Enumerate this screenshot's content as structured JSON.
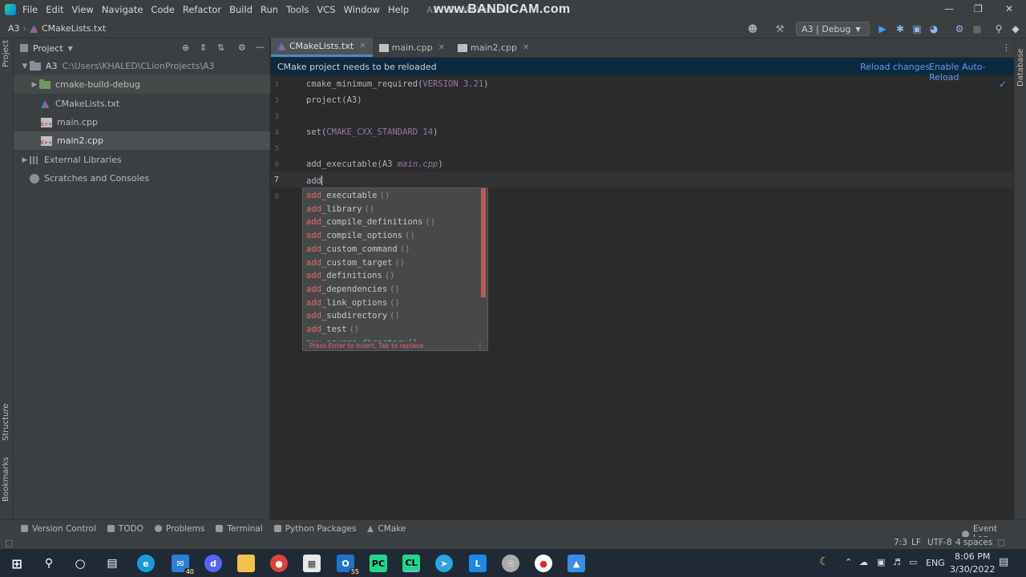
{
  "window": {
    "menu": [
      "File",
      "Edit",
      "View",
      "Navigate",
      "Code",
      "Refactor",
      "Build",
      "Run",
      "Tools",
      "VCS",
      "Window",
      "Help"
    ],
    "title": "A3 - CMakeLists.tx",
    "watermark": "www.BANDICAM.com"
  },
  "navbar": {
    "project": "A3",
    "file": "CMakeLists.txt",
    "run_config": "A3 | Debug"
  },
  "project_panel": {
    "title": "Project",
    "tree": [
      {
        "label": "A3",
        "path": "C:\\Users\\KHALED\\CLionProjects\\A3",
        "kind": "folder"
      },
      {
        "label": "cmake-build-debug",
        "kind": "build-folder"
      },
      {
        "label": "CMakeLists.txt",
        "kind": "cmake"
      },
      {
        "label": "main.cpp",
        "kind": "cpp"
      },
      {
        "label": "main2.cpp",
        "kind": "cpp"
      },
      {
        "label": "External Libraries",
        "kind": "library"
      },
      {
        "label": "Scratches and Consoles",
        "kind": "scratch"
      }
    ]
  },
  "side_labels": {
    "project": "Project",
    "structure": "Structure",
    "bookmarks": "Bookmarks",
    "database": "Database"
  },
  "editor": {
    "tabs": [
      {
        "label": "CMakeLists.txt",
        "active": true
      },
      {
        "label": "main.cpp",
        "active": false
      },
      {
        "label": "main2.cpp",
        "active": false
      }
    ],
    "notice": {
      "text": "CMake project needs to be reloaded",
      "reload": "Reload changes",
      "auto_reload": "Enable Auto-Reload"
    },
    "current_line": "7",
    "code": {
      "l1_fn": "cmake_minimum_required(",
      "l1_arg": "VERSION 3.21",
      "l1_end": ")",
      "l2": "project(A3)",
      "l4_fn": "set(",
      "l4_arg": "CMAKE_CXX_STANDARD 14",
      "l4_end": ")",
      "l6_fn": "add_executable(A3 ",
      "l6_arg": "main.cpp",
      "l6_end": ")",
      "l7": "add"
    }
  },
  "completion": {
    "typed": "add",
    "items": [
      "_executable",
      "_library",
      "_compile_definitions",
      "_compile_options",
      "_custom_command",
      "_custom_target",
      "_definitions",
      "_dependencies",
      "_link_options",
      "_subdirectory",
      "_test"
    ],
    "partial_item": "aux_source_directory",
    "parens": "()",
    "footer": "Press Enter to insert, Tab to replace"
  },
  "bottom_tools": [
    "Version Control",
    "TODO",
    "Problems",
    "Terminal",
    "Python Packages",
    "CMake"
  ],
  "event_log": "Event Log",
  "status": {
    "position": "7:3",
    "line_sep": "LF",
    "encoding": "UTF-8",
    "indent": "4 spaces"
  },
  "taskbar": {
    "mail_badge": "40",
    "outlook_badge": "55",
    "lang": "ENG",
    "time": "8:06 PM",
    "date": "3/30/2022"
  }
}
